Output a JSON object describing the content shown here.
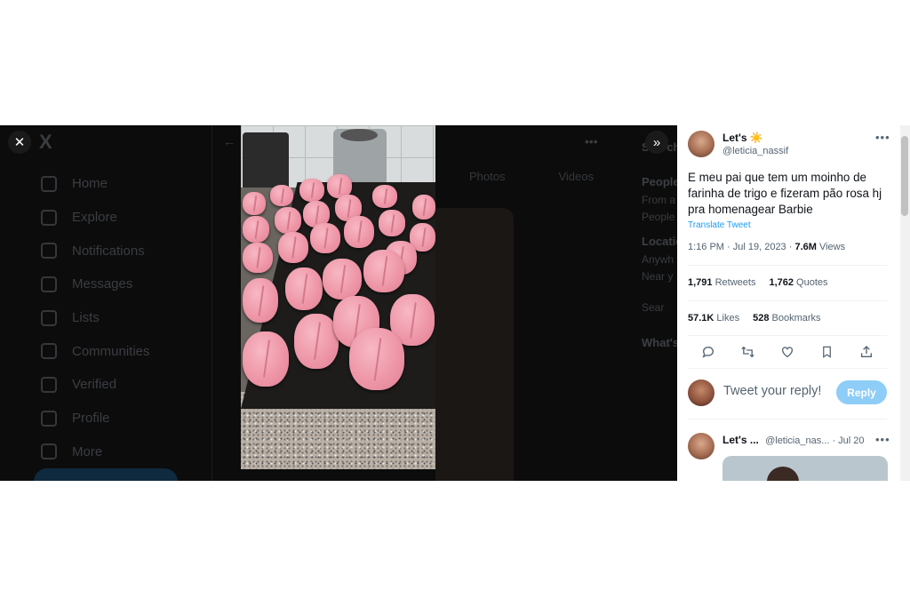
{
  "background_app": {
    "logo": "X",
    "nav": [
      "Home",
      "Explore",
      "Notifications",
      "Messages",
      "Lists",
      "Communities",
      "Verified",
      "Profile",
      "More"
    ],
    "tabs": [
      "Photos",
      "Videos"
    ],
    "right_panel": {
      "heading_1": "Search",
      "people_label": "People",
      "location_label": "Location",
      "whats_label": "What's",
      "row_texts": [
        "From a",
        "People",
        "Anywh",
        "Near y",
        "Sear"
      ]
    }
  },
  "viewer": {
    "close_icon": "close-icon",
    "expand_icon": "chevrons-right-icon",
    "photo_alt": "Pink bread rolls on a baking tray"
  },
  "tweet": {
    "display_name": "Let's ☀️",
    "handle": "@leticia_nassif",
    "text": "E meu pai que tem um moinho de farinha de trigo e fizeram pão rosa hj pra homenagear Barbie",
    "translate_label": "Translate Tweet",
    "time": "1:16 PM · Jul 19, 2023 · ",
    "views_count": "7.6M",
    "views_label": " Views",
    "retweets_count": "1,791",
    "retweets_label": " Retweets",
    "quotes_count": "1,762",
    "quotes_label": " Quotes",
    "likes_count": "57.1K",
    "likes_label": " Likes",
    "bookmarks_count": "528",
    "bookmarks_label": " Bookmarks"
  },
  "reply_box": {
    "placeholder": "Tweet your reply!",
    "button_label": "Reply"
  },
  "next_tweet": {
    "display_name": "Let's ...",
    "handle": "@leticia_nas...",
    "separator": " · ",
    "date": "Jul 20"
  },
  "colors": {
    "accent": "#1d9bf0",
    "reply_button": "#8ecdf8"
  }
}
